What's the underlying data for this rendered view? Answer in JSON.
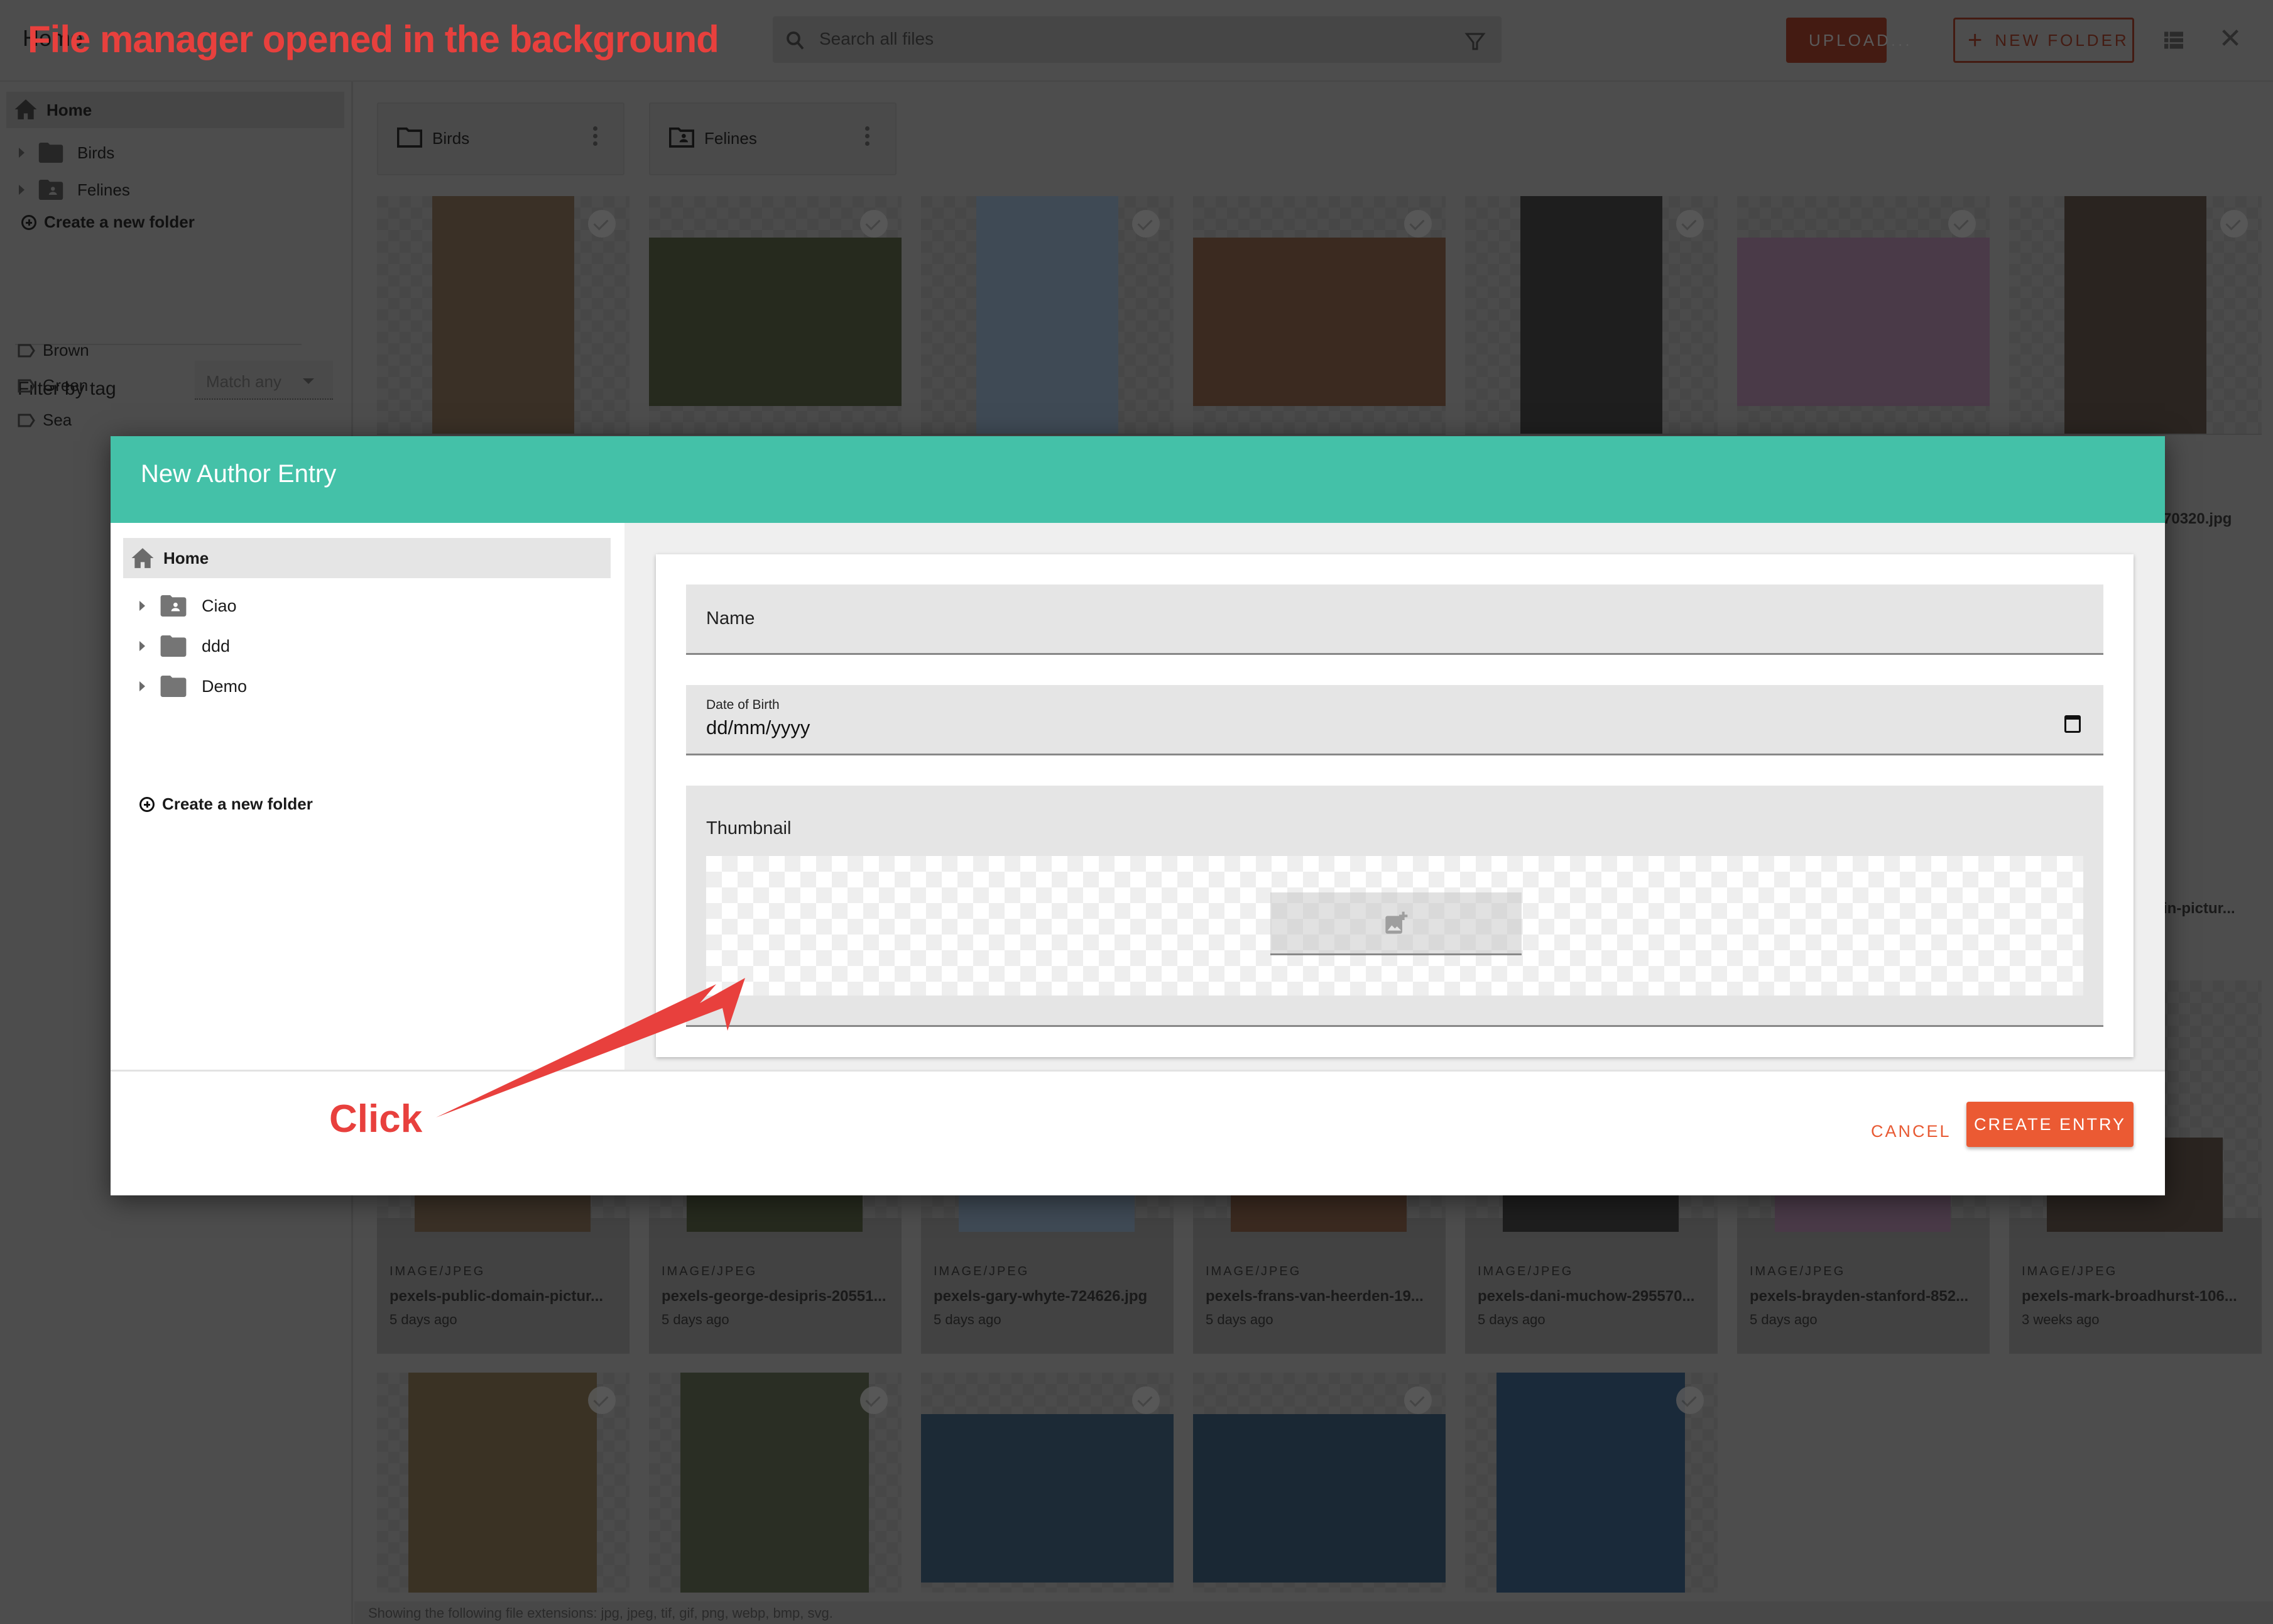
{
  "annotations": {
    "top_note": "File manager opened in the background",
    "click_note": "Click",
    "color": "#e8403d"
  },
  "file_manager": {
    "title": "Home",
    "search": {
      "placeholder": "Search all files"
    },
    "toolbar": {
      "upload_label": "UPLOAD...",
      "new_folder_label": "NEW FOLDER"
    },
    "sidebar": {
      "home_label": "Home",
      "folders": [
        {
          "label": "Birds",
          "icon": "folder-icon"
        },
        {
          "label": "Felines",
          "icon": "shared-folder-icon"
        }
      ],
      "create_folder_label": "Create a new folder",
      "filter_label": "Filter by tag",
      "match_select": "Match any",
      "tags": [
        "Brown",
        "Green",
        "Sea"
      ]
    },
    "folder_cards": [
      {
        "label": "Birds"
      },
      {
        "label": "Felines"
      }
    ],
    "files_row1_partial": [
      {
        "name_fragment": "70320.jpg"
      },
      {
        "name_fragment": "in-pictur..."
      }
    ],
    "files_row2": [
      {
        "mime": "IMAGE/JPEG",
        "name": "pexels-public-domain-pictur...",
        "date": "5 days ago"
      },
      {
        "mime": "IMAGE/JPEG",
        "name": "pexels-george-desipris-20551...",
        "date": "5 days ago"
      },
      {
        "mime": "IMAGE/JPEG",
        "name": "pexels-gary-whyte-724626.jpg",
        "date": "5 days ago"
      },
      {
        "mime": "IMAGE/JPEG",
        "name": "pexels-frans-van-heerden-19...",
        "date": "5 days ago"
      },
      {
        "mime": "IMAGE/JPEG",
        "name": "pexels-dani-muchow-295570...",
        "date": "5 days ago"
      },
      {
        "mime": "IMAGE/JPEG",
        "name": "pexels-brayden-stanford-852...",
        "date": "5 days ago"
      },
      {
        "mime": "IMAGE/JPEG",
        "name": "pexels-mark-broadhurst-106...",
        "date": "3 weeks ago"
      }
    ],
    "footer_note": "Showing the following file extensions: jpg, jpeg, tif, gif, png, webp, bmp, svg."
  },
  "modal": {
    "title": "New Author Entry",
    "header_color": "#44c1a8",
    "tree": {
      "home_label": "Home",
      "folders": [
        {
          "label": "Ciao",
          "icon": "shared-folder-icon"
        },
        {
          "label": "ddd",
          "icon": "folder-icon"
        },
        {
          "label": "Demo",
          "icon": "folder-icon"
        }
      ],
      "create_folder_label": "Create a new folder"
    },
    "form": {
      "name_label": "Name",
      "dob_label": "Date of Birth",
      "dob_placeholder": "dd/mm/yyyy",
      "thumbnail_label": "Thumbnail"
    },
    "actions": {
      "cancel_label": "CANCEL",
      "create_label": "CREATE ENTRY",
      "accent": "#eb5a33"
    }
  }
}
